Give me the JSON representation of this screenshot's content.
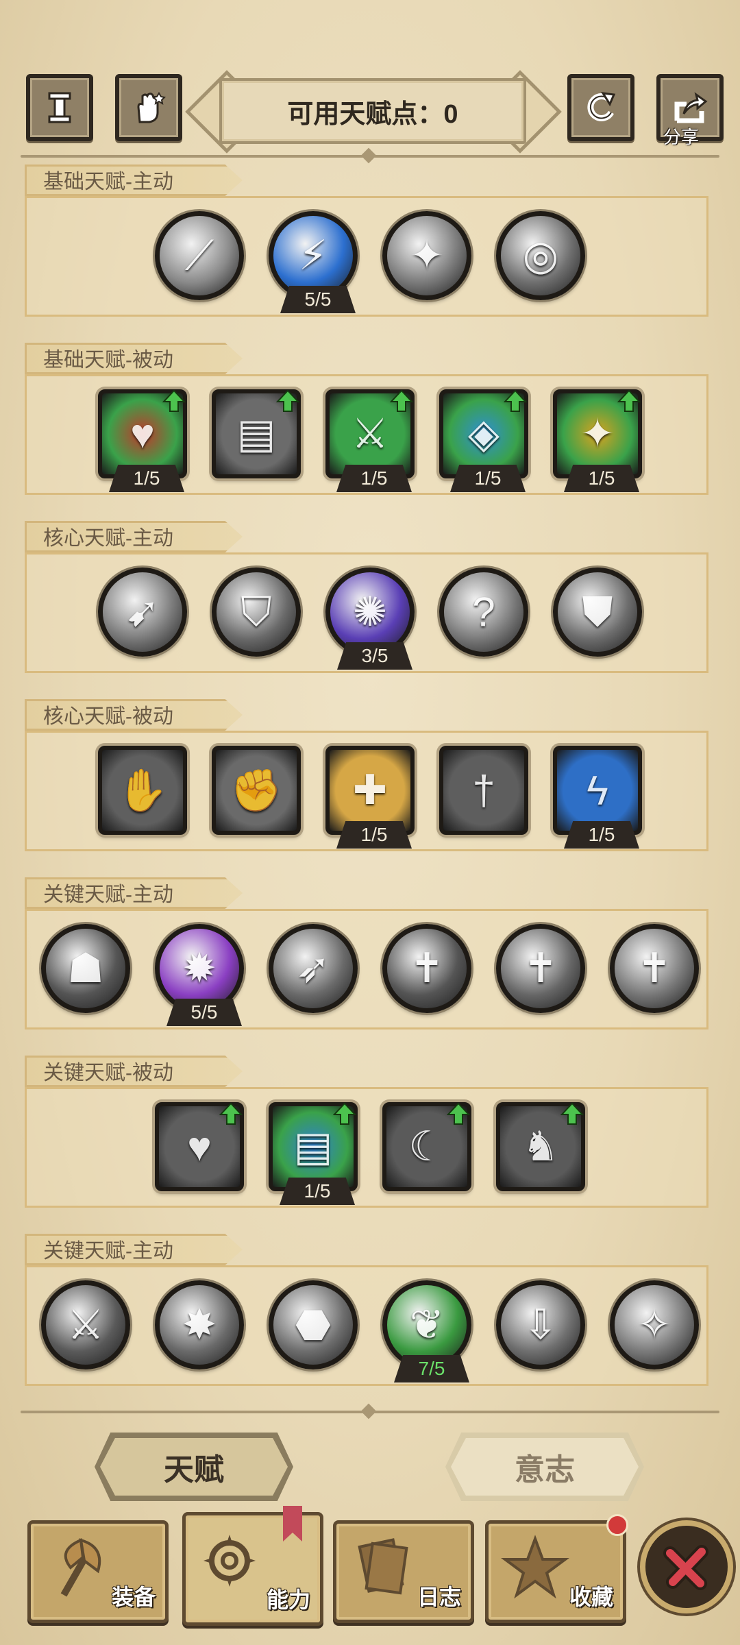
{
  "header": {
    "title": "可用天赋点：0",
    "share_label": "分享",
    "buttons": [
      "info-icon",
      "hand-icon",
      "reset-icon",
      "share-icon"
    ]
  },
  "sections": [
    {
      "title": "基础天赋-主动",
      "shape": "round",
      "icons": [
        {
          "name": "slash-skill-icon",
          "theme": "#8a8a8a",
          "glyph": "⟋",
          "badge": ""
        },
        {
          "name": "lightning-skill-icon",
          "theme": "#2c6fcf",
          "glyph": "⚡",
          "badge": "5/5"
        },
        {
          "name": "shatter-skill-icon",
          "theme": "#7b7b7b",
          "glyph": "✦",
          "badge": ""
        },
        {
          "name": "spin-skill-icon",
          "theme": "#6f6f6f",
          "glyph": "◎",
          "badge": ""
        }
      ]
    },
    {
      "title": "基础天赋-被动",
      "shape": "square",
      "icons": [
        {
          "name": "heart-upgrade-icon",
          "theme": "#3aa24a",
          "glyph": "♥",
          "badge": "1/5",
          "up": true,
          "inner": "#c0392b"
        },
        {
          "name": "book-upgrade-icon",
          "theme": "#6b6b6b",
          "glyph": "▤",
          "badge": "",
          "up": true
        },
        {
          "name": "swords-upgrade-icon",
          "theme": "#3aa24a",
          "glyph": "⚔",
          "badge": "1/5",
          "up": true
        },
        {
          "name": "crystal-upgrade-icon",
          "theme": "#3aa24a",
          "glyph": "◈",
          "badge": "1/5",
          "up": true,
          "inner": "#2f8fd2"
        },
        {
          "name": "star-upgrade-icon",
          "theme": "#3aa24a",
          "glyph": "✦",
          "badge": "1/5",
          "up": true,
          "inner": "#d8a320"
        }
      ]
    },
    {
      "title": "核心天赋-主动",
      "shape": "round",
      "icons": [
        {
          "name": "dash-skill-icon",
          "theme": "#7a7a7a",
          "glyph": "➹",
          "badge": ""
        },
        {
          "name": "shield-break-skill-icon",
          "theme": "#6a6a6a",
          "glyph": "⛉",
          "badge": ""
        },
        {
          "name": "vortex-skill-icon",
          "theme": "#5a3fb5",
          "glyph": "✺",
          "badge": "3/5"
        },
        {
          "name": "confuse-skill-icon",
          "theme": "#7a7a7a",
          "glyph": "?",
          "badge": ""
        },
        {
          "name": "guard-skill-icon",
          "theme": "#6d6d6d",
          "glyph": "⛊",
          "badge": ""
        }
      ]
    },
    {
      "title": "核心天赋-被动",
      "shape": "square",
      "icons": [
        {
          "name": "grab-passive-icon",
          "theme": "#5f5f5f",
          "glyph": "✋",
          "badge": ""
        },
        {
          "name": "fist-passive-icon",
          "theme": "#6a6a6a",
          "glyph": "✊",
          "badge": ""
        },
        {
          "name": "holy-shield-passive-icon",
          "theme": "#d6a746",
          "glyph": "✚",
          "badge": "1/5"
        },
        {
          "name": "dagger-passive-icon",
          "theme": "#5e5e5e",
          "glyph": "†",
          "badge": ""
        },
        {
          "name": "shock-passive-icon",
          "theme": "#2e6fc6",
          "glyph": "ϟ",
          "badge": "1/5"
        }
      ]
    },
    {
      "title": "关键天赋-主动",
      "shape": "round",
      "icons": [
        {
          "name": "mask-skill-icon",
          "theme": "#555555",
          "glyph": "☗",
          "badge": ""
        },
        {
          "name": "curse-skill-icon",
          "theme": "#8a3fc2",
          "glyph": "✹",
          "badge": "5/5"
        },
        {
          "name": "charge-skill-icon",
          "theme": "#6a6a6a",
          "glyph": "➶",
          "badge": ""
        },
        {
          "name": "sword-burst-skill-icon-1",
          "theme": "#555555",
          "glyph": "✝",
          "badge": ""
        },
        {
          "name": "sword-burst-skill-icon-2",
          "theme": "#666666",
          "glyph": "✝",
          "badge": ""
        },
        {
          "name": "sword-burst-skill-icon-3",
          "theme": "#777777",
          "glyph": "✝",
          "badge": ""
        }
      ]
    },
    {
      "title": "关键天赋-被动",
      "shape": "square",
      "icons": [
        {
          "name": "heal-heart-upgrade-icon",
          "theme": "#5e5e5e",
          "glyph": "♥",
          "badge": "",
          "up": true
        },
        {
          "name": "holy-book-upgrade-icon",
          "theme": "#3aa24a",
          "glyph": "▤",
          "badge": "1/5",
          "up": true,
          "inner": "#2f7fd0"
        },
        {
          "name": "crescent-upgrade-icon",
          "theme": "#5a5a5a",
          "glyph": "☾",
          "badge": "",
          "up": true
        },
        {
          "name": "runner-upgrade-icon",
          "theme": "#5a5a5a",
          "glyph": "♞",
          "badge": "",
          "up": true
        }
      ]
    },
    {
      "title": "关键天赋-主动",
      "shape": "round",
      "icons": [
        {
          "name": "greatsword-skill-icon",
          "theme": "#5a5a5a",
          "glyph": "⚔",
          "badge": ""
        },
        {
          "name": "explosion-skill-icon",
          "theme": "#6a6a6a",
          "glyph": "✸",
          "badge": ""
        },
        {
          "name": "rock-throw-skill-icon",
          "theme": "#6d6d6d",
          "glyph": "⬣",
          "badge": ""
        },
        {
          "name": "nature-skill-icon",
          "theme": "#3a9a40",
          "glyph": "❦",
          "badge": "7/5",
          "badge_green": true
        },
        {
          "name": "sword-rain-skill-icon",
          "theme": "#6f6f6f",
          "glyph": "⇩",
          "badge": ""
        },
        {
          "name": "crack-skill-icon",
          "theme": "#7a7a7a",
          "glyph": "✧",
          "badge": ""
        }
      ]
    }
  ],
  "tabs": {
    "talent": "天赋",
    "will": "意志"
  },
  "nav": {
    "equipment": "装备",
    "ability": "能力",
    "journal": "日志",
    "collection": "收藏"
  }
}
